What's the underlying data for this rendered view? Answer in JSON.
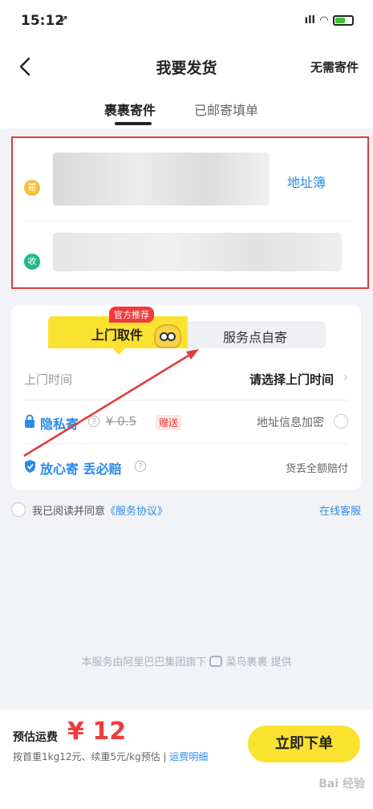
{
  "status_bar": {
    "time": "15:12",
    "signal": "ıll"
  },
  "nav": {
    "title": "我要发货",
    "right_action": "无需寄件"
  },
  "tabs": [
    {
      "label": "裹裹寄件"
    },
    {
      "label": "已邮寄填单"
    }
  ],
  "address": {
    "send_icon": "寄",
    "receive_icon": "收",
    "address_book": "地址簿"
  },
  "service": {
    "badge": "官方推荐",
    "segments": [
      {
        "label": "上门取件"
      },
      {
        "label": "服务点自寄"
      }
    ],
    "pickup_time": {
      "label": "上门时间",
      "value": "请选择上门时间"
    },
    "privacy": {
      "label": "隐私寄",
      "old_price": "¥ 0.5",
      "gift": "赠送",
      "encrypt": "地址信息加密"
    },
    "worry_free": {
      "label": "放心寄 丢必赔",
      "right": "货丢全额赔付"
    }
  },
  "agreement": {
    "prefix": "我已阅读并同意",
    "link": "《服务协议》",
    "online_service": "在线客服"
  },
  "provider": {
    "prefix": "本服务由阿里巴巴集团旗下",
    "suffix": "菜鸟裹裹 提供"
  },
  "bottom": {
    "est_label": "预估运费",
    "price": "¥ 12",
    "note": "按首重1kg12元、续重5元/kg预估 | ",
    "note_link": "运费明细",
    "order_button": "立即下单"
  },
  "watermark": "Bai 经验",
  "colors": {
    "accent_yellow": "#fce230",
    "link_blue": "#2b8be8",
    "highlight_red": "#e13a3a",
    "price_red": "#ef3b3b"
  }
}
